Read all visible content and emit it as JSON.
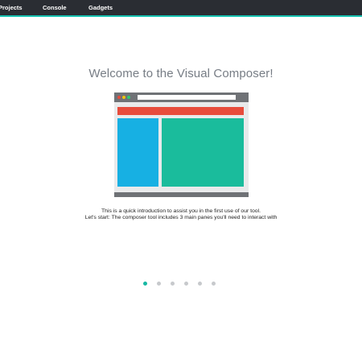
{
  "nav": {
    "items": [
      {
        "label": "Projects"
      },
      {
        "label": "Console"
      },
      {
        "label": "Gadgets"
      }
    ]
  },
  "colors": {
    "topbar_bg": "#2a2d33",
    "accent": "#17c3b2",
    "title_text": "#777d85",
    "illustration_header": "#e74c3c",
    "illustration_left_pane": "#17b0e3",
    "illustration_right_pane": "#1abc9c",
    "window_chrome": "#6f7276"
  },
  "welcome": {
    "title": "Welcome to the Visual Composer!",
    "line1": "This is a quick introduction to assist you in the first use of our tool.",
    "line2": "Let's start: The composer tool includes 3 main panes you'll need to interact with"
  },
  "pagination": {
    "total": 6,
    "active_index": 0
  },
  "illustration": {
    "icon": "browser-window-illustration"
  }
}
